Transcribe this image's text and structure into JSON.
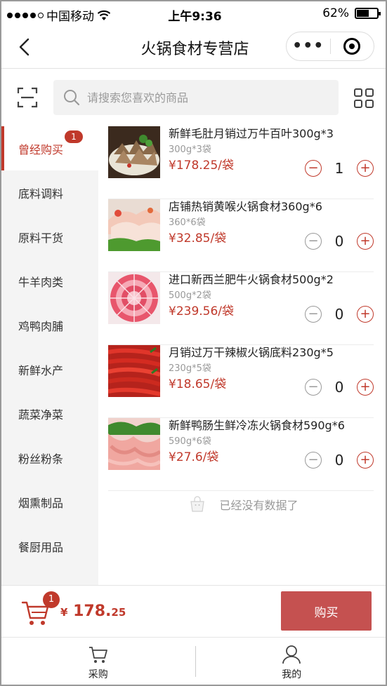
{
  "status_bar": {
    "carrier": "中国移动",
    "time": "上午9:36",
    "battery": "62%",
    "battery_level": 0.62
  },
  "navbar": {
    "title": "火锅食材专营店",
    "more_label": "•••"
  },
  "search": {
    "placeholder": "请搜索您喜欢的商品"
  },
  "sidebar": {
    "items": [
      {
        "label": "曾经购买",
        "active": true,
        "badge": "1"
      },
      {
        "label": "底料调料"
      },
      {
        "label": "原料干货"
      },
      {
        "label": "牛羊肉类"
      },
      {
        "label": "鸡鸭肉脯"
      },
      {
        "label": "新鲜水产"
      },
      {
        "label": "蔬菜净菜"
      },
      {
        "label": "粉丝粉条"
      },
      {
        "label": "烟熏制品"
      },
      {
        "label": "餐厨用品"
      }
    ]
  },
  "products": [
    {
      "name": "新鲜毛肚月销过万牛百叶300g*3",
      "spec": "300g*3袋",
      "price": "¥178.25/袋",
      "qty": "1"
    },
    {
      "name": "店铺热销黄喉火锅食材360g*6",
      "spec": "360*6袋",
      "price": "¥32.85/袋",
      "qty": "0"
    },
    {
      "name": "进口新西兰肥牛火锅食材500g*2",
      "spec": "500g*2袋",
      "price": "¥239.56/袋",
      "qty": "0"
    },
    {
      "name": "月销过万干辣椒火锅底料230g*5",
      "spec": "230g*5袋",
      "price": "¥18.65/袋",
      "qty": "0"
    },
    {
      "name": "新鲜鸭肠生鲜冷冻火锅食材590g*6",
      "spec": "590g*6袋",
      "price": "¥27.6/袋",
      "qty": "0"
    }
  ],
  "list_footer": "已经没有数据了",
  "cart": {
    "badge": "1",
    "currency": "¥",
    "total_main": "178.",
    "total_cents": "25",
    "buy_label": "购买"
  },
  "tabbar": {
    "tabs": [
      {
        "label": "采购"
      },
      {
        "label": "我的"
      }
    ]
  },
  "colors": {
    "accent": "#c0392b",
    "buy_button": "#c55150"
  }
}
